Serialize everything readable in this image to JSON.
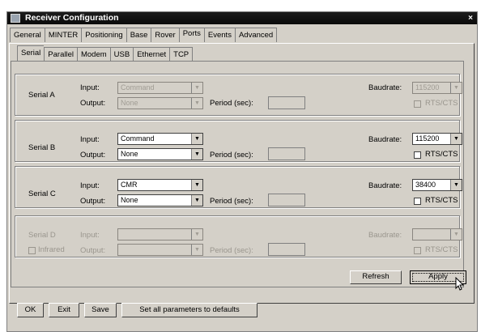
{
  "window": {
    "title": "Receiver Configuration",
    "close_glyph": "×",
    "icon": "app-icon"
  },
  "top_tabs": [
    {
      "label": "General"
    },
    {
      "label": "MINTER"
    },
    {
      "label": "Positioning"
    },
    {
      "label": "Base"
    },
    {
      "label": "Rover"
    },
    {
      "label": "Ports"
    },
    {
      "label": "Events"
    },
    {
      "label": "Advanced"
    }
  ],
  "active_top_tab": "Ports",
  "sub_tabs": [
    {
      "label": "Serial"
    },
    {
      "label": "Parallel"
    },
    {
      "label": "Modem"
    },
    {
      "label": "USB"
    },
    {
      "label": "Ethernet"
    },
    {
      "label": "TCP"
    }
  ],
  "active_sub_tab": "Serial",
  "common": {
    "input_label": "Input:",
    "output_label": "Output:",
    "period_label": "Period (sec):",
    "baud_label": "Baudrate:",
    "rts_label": "RTS/CTS"
  },
  "ports": [
    {
      "name": "Serial A",
      "input": "Command",
      "output": "None",
      "baud": "115200",
      "enabled": false,
      "rts_enabled": false
    },
    {
      "name": "Serial B",
      "input": "Command",
      "output": "None",
      "baud": "115200",
      "enabled": true,
      "rts_enabled": true
    },
    {
      "name": "Serial C",
      "input": "CMR",
      "output": "None",
      "baud": "38400",
      "enabled": true,
      "rts_enabled": true
    },
    {
      "name": "Serial D",
      "input": "",
      "output": "",
      "baud": "",
      "enabled": false,
      "rts_enabled": false,
      "extra_checkbox": "Infrared"
    }
  ],
  "buttons": {
    "refresh": "Refresh",
    "apply": "Apply"
  },
  "bottom_buttons": [
    {
      "label": "OK"
    },
    {
      "label": "Exit"
    },
    {
      "label": "Save"
    },
    {
      "label": "Set all parameters to defaults"
    }
  ]
}
